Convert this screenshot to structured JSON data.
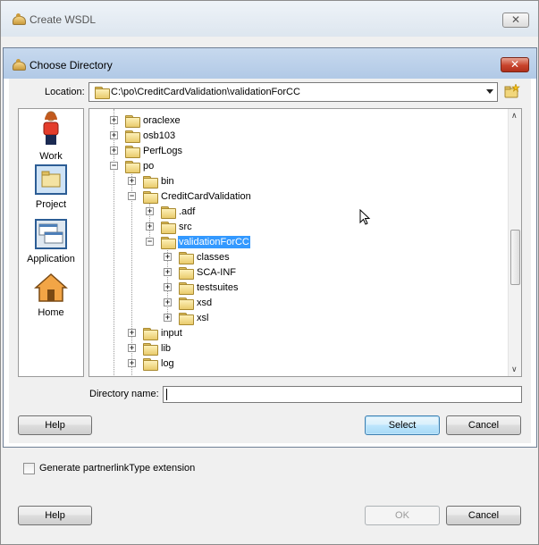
{
  "outer_window": {
    "title": "Create WSDL",
    "close_label": "✕",
    "checkbox_label": "Generate partnerlinkType extension",
    "help_label": "Help",
    "ok_label": "OK",
    "cancel_label": "Cancel"
  },
  "dialog": {
    "title": "Choose Directory",
    "close_label": "✕",
    "location_label": "Location:",
    "location_value": "C:\\po\\CreditCardValidation\\validationForCC",
    "shortcuts": [
      {
        "label": "Work",
        "icon": "work-person-icon"
      },
      {
        "label": "Project",
        "icon": "project-icon"
      },
      {
        "label": "Application",
        "icon": "application-icon"
      },
      {
        "label": "Home",
        "icon": "home-icon"
      }
    ],
    "tree": [
      {
        "label": "oraclexe",
        "expander": "+"
      },
      {
        "label": "osb103",
        "expander": "+"
      },
      {
        "label": "PerfLogs",
        "expander": "+"
      },
      {
        "label": "po",
        "expander": "−"
      },
      {
        "label": "bin",
        "expander": "+"
      },
      {
        "label": "CreditCardValidation",
        "expander": "−"
      },
      {
        "label": ".adf",
        "expander": "+"
      },
      {
        "label": "src",
        "expander": "+"
      },
      {
        "label": "validationForCC",
        "expander": "−",
        "selected": true
      },
      {
        "label": "classes",
        "expander": "+"
      },
      {
        "label": "SCA-INF",
        "expander": "+"
      },
      {
        "label": "testsuites",
        "expander": "+"
      },
      {
        "label": "xsd",
        "expander": "+"
      },
      {
        "label": "xsl",
        "expander": "+"
      },
      {
        "label": "input",
        "expander": "+"
      },
      {
        "label": "lib",
        "expander": "+"
      },
      {
        "label": "log",
        "expander": "+"
      }
    ],
    "directory_name_label": "Directory name:",
    "directory_name_value": "",
    "help_label": "Help",
    "select_label": "Select",
    "cancel_label": "Cancel"
  },
  "colors": {
    "selection": "#3399ff",
    "close_red": "#c8432c"
  }
}
